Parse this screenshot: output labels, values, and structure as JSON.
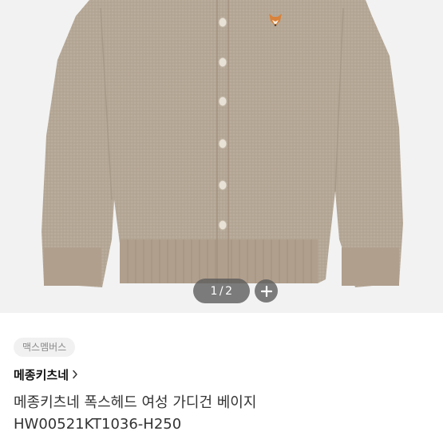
{
  "pager": {
    "current": "1",
    "separator": "/",
    "total": "2"
  },
  "tag": {
    "label": "맥스멤버스"
  },
  "brand": {
    "name": "메종키츠네"
  },
  "product": {
    "title_line1": "메종키츠네 폭스헤드 여성 가디건 베이지",
    "title_line2": "HW00521KT1036-H250"
  },
  "icons": {
    "zoom": "plus-icon",
    "brand_link": "chevron-right-icon",
    "logo": "fox-head-icon"
  },
  "colors": {
    "image_background": "#f2f2f2",
    "cardigan": "#b5a796",
    "pager_background": "#5a5a5a",
    "tag_background": "#f1f1f1",
    "tag_text": "#8a8a8a"
  }
}
